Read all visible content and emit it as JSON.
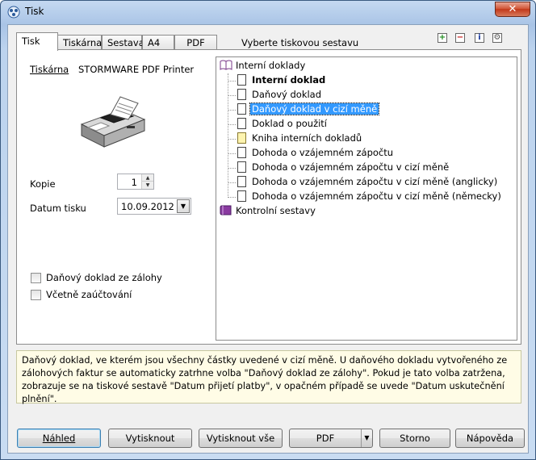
{
  "window": {
    "title": "Tisk",
    "close_glyph": "✕"
  },
  "tabs": [
    {
      "label": "Tisk",
      "active": true
    },
    {
      "label": "Tiskárna"
    },
    {
      "label": "Sestava"
    },
    {
      "label": "A4"
    },
    {
      "label": "PDF"
    }
  ],
  "hint": "Vyberte tiskovou sestavu",
  "toolbar": {
    "icons": [
      "add-icon",
      "remove-icon",
      "info-icon",
      "settings-icon"
    ],
    "glyphs": [
      "+",
      "−",
      "i",
      "⚙"
    ]
  },
  "printer": {
    "link_label": "Tiskárna",
    "name": "STORMWARE PDF Printer"
  },
  "copies": {
    "label": "Kopie",
    "value": "1"
  },
  "print_date": {
    "label": "Datum tisku",
    "value": "10.09.2012"
  },
  "checkboxes": [
    {
      "label": "Daňový doklad ze zálohy",
      "checked": false
    },
    {
      "label": "Včetně zaúčtování",
      "checked": false
    }
  ],
  "tree": {
    "root1": "Interní doklady",
    "items": [
      "Interní doklad",
      "Daňový doklad",
      "Daňový doklad v cizí měně",
      "Doklad o použití",
      "Kniha interních dokladů",
      "Dohoda o vzájemném zápočtu",
      "Dohoda o vzájemném zápočtu v cizí měně",
      "Dohoda o vzájemném zápočtu v cizí měně (anglicky)",
      "Dohoda o vzájemném zápočtu v cizí měně (německy)"
    ],
    "root2": "Kontrolní sestavy"
  },
  "description": "Daňový doklad, ve kterém jsou všechny částky uvedené v cizí měně. U daňového dokladu vytvořeného ze zálohových faktur se automaticky zatrhne volba \"Daňový doklad ze zálohy\". Pokud je tato volba zatržena, zobrazuje se na tiskové sestavě \"Datum přijetí platby\", v opačném případě se uvede \"Datum uskutečnění plnění\".",
  "buttons": {
    "preview": "Náhled",
    "print": "Vytisknout",
    "print_all": "Vytisknout vše",
    "pdf": "PDF",
    "cancel": "Storno",
    "help": "Nápověda"
  },
  "colors": {
    "selection": "#3399ff",
    "description_bg": "#fffce6"
  }
}
